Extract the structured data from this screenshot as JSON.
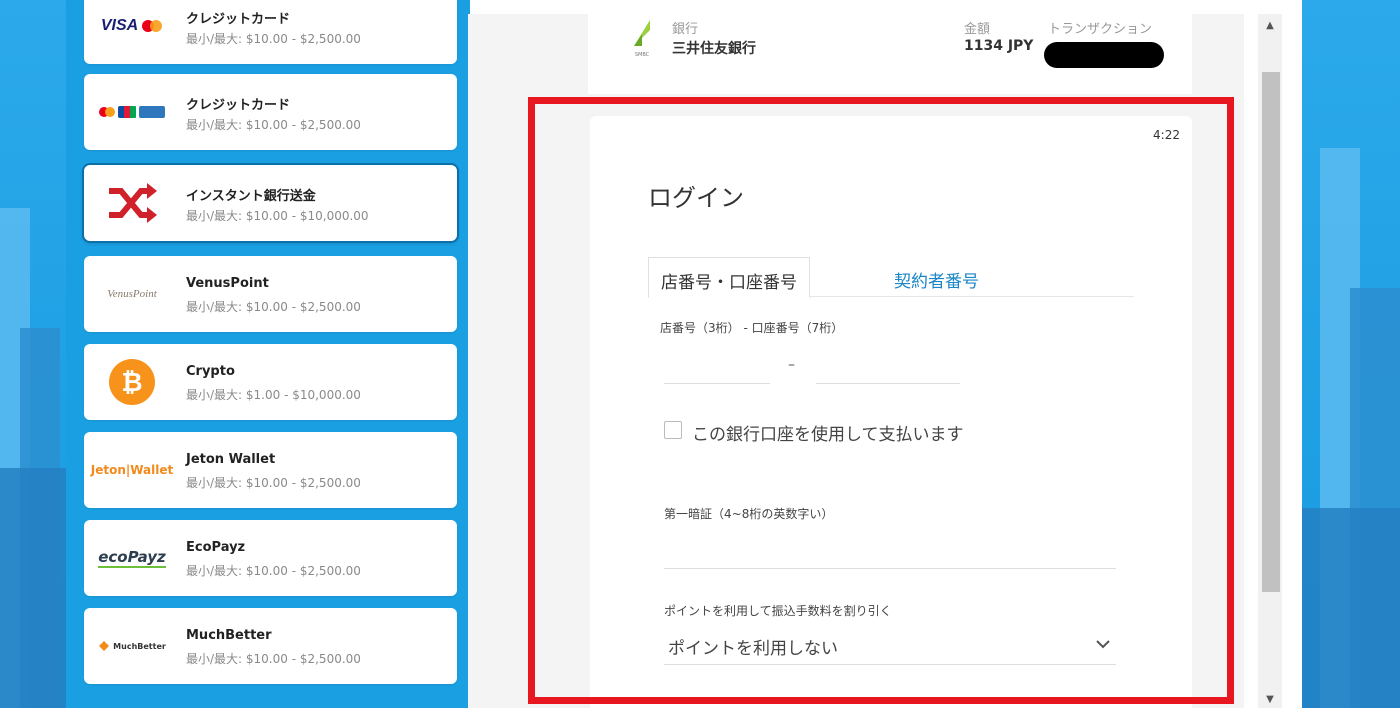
{
  "colors": {
    "page_blue": "#1a9fe3",
    "highlight_red": "#e8161f",
    "tab_link_blue": "#1b86c8",
    "visa_blue": "#1a1f71",
    "mc_red": "#eb001b",
    "mc_orange": "#f79e1b",
    "instant_red": "#d0202a",
    "bitcoin_orange": "#f7931a",
    "jeton_orange": "#f28a1c",
    "ecopayz_green": "#6bbf3a",
    "smbc_green": "#9bd03e"
  },
  "payment_methods": [
    {
      "name": "クレジットカード",
      "range": "最小/最大: $10.00 - $2,500.00",
      "logo": "visa-mastercard-logo",
      "logo_text": "VISA"
    },
    {
      "name": "クレジットカード",
      "range": "最小/最大: $10.00 - $2,500.00",
      "logo": "card-brands-logo",
      "logo_text": ""
    },
    {
      "name": "インスタント銀行送金",
      "range": "最小/最大: $10.00 - $10,000.00",
      "logo": "shuffle-transfer-icon",
      "logo_text": ""
    },
    {
      "name": "VenusPoint",
      "range": "最小/最大: $10.00 - $2,500.00",
      "logo": "venuspoint-logo",
      "logo_text": "VenusPoint"
    },
    {
      "name": "Crypto",
      "range": "最小/最大: $1.00 - $10,000.00",
      "logo": "bitcoin-icon",
      "logo_text": "₿"
    },
    {
      "name": "Jeton Wallet",
      "range": "最小/最大: $10.00 - $2,500.00",
      "logo": "jeton-wallet-logo",
      "logo_text": "Jeton|Wallet"
    },
    {
      "name": "EcoPayz",
      "range": "最小/最大: $10.00 - $2,500.00",
      "logo": "ecopayz-logo",
      "logo_text": "ecoPayz"
    },
    {
      "name": "MuchBetter",
      "range": "最小/最大: $10.00 - $2,500.00",
      "logo": "muchbetter-logo",
      "logo_text": "MuchBetter"
    }
  ],
  "bank_header": {
    "bank_label": "銀行",
    "bank_name": "三井住友銀行",
    "smbc_logo_text": "SMBC",
    "amount_label": "金額",
    "amount_value": "1134 JPY",
    "transaction_label": "トランザクション"
  },
  "login": {
    "timer": "4:22",
    "title": "ログイン",
    "tabs": [
      "店番号・口座番号",
      "契約者番号"
    ],
    "branch_account_label": "店番号（3桁） - 口座番号（7桁）",
    "dash": "–",
    "checkbox_label": "この銀行口座を使用して支払います",
    "password_label": "第一暗証（4~8桁の英数字い）",
    "points_label": "ポイントを利用して振込手数料を割り引く",
    "points_value": "ポイントを利用しない"
  }
}
